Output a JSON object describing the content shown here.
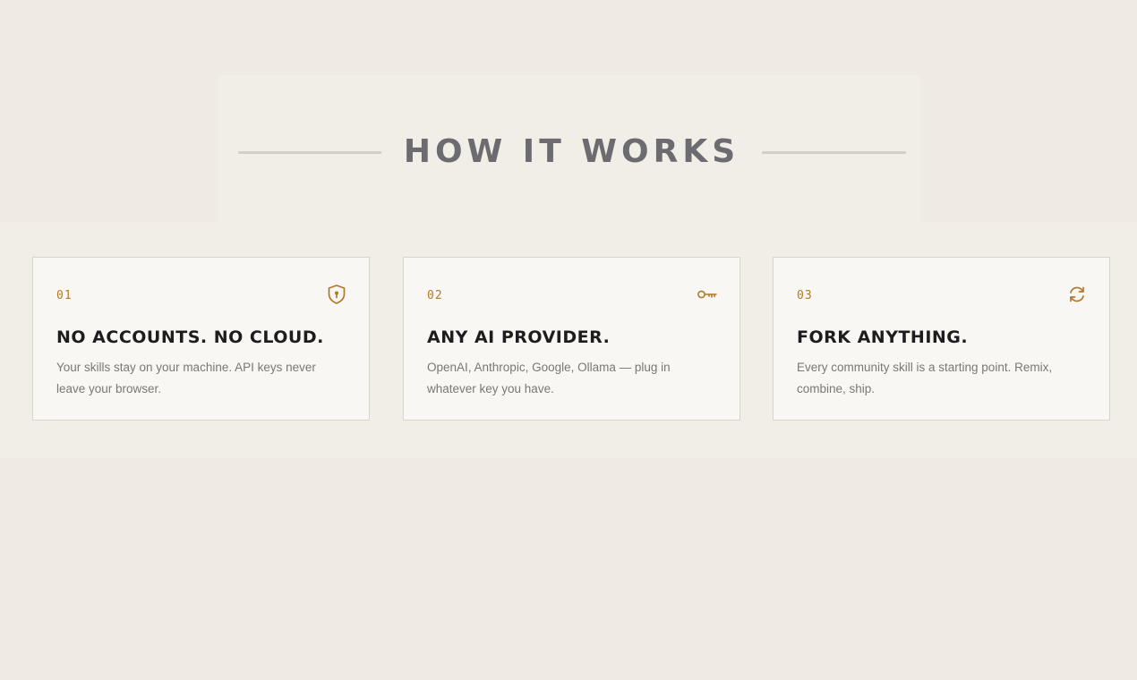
{
  "section": {
    "title": "HOW IT WORKS"
  },
  "colors": {
    "accent": "#b07a2c",
    "title": "#6c6b6f",
    "heading": "#1d1c1f",
    "body_text": "#7a7874",
    "page_background": "#efebe4",
    "card_background": "#f9f7f3"
  },
  "cards": [
    {
      "number": "01",
      "icon": "shield-keyhole-icon",
      "title": "NO ACCOUNTS. NO CLOUD.",
      "description": "Your skills stay on your machine. API keys never leave your browser."
    },
    {
      "number": "02",
      "icon": "key-icon",
      "title": "ANY AI PROVIDER.",
      "description": "OpenAI, Anthropic, Google, Ollama — plug in whatever key you have."
    },
    {
      "number": "03",
      "icon": "refresh-icon",
      "title": "FORK ANYTHING.",
      "description": "Every community skill is a starting point. Remix, combine, ship."
    }
  ]
}
